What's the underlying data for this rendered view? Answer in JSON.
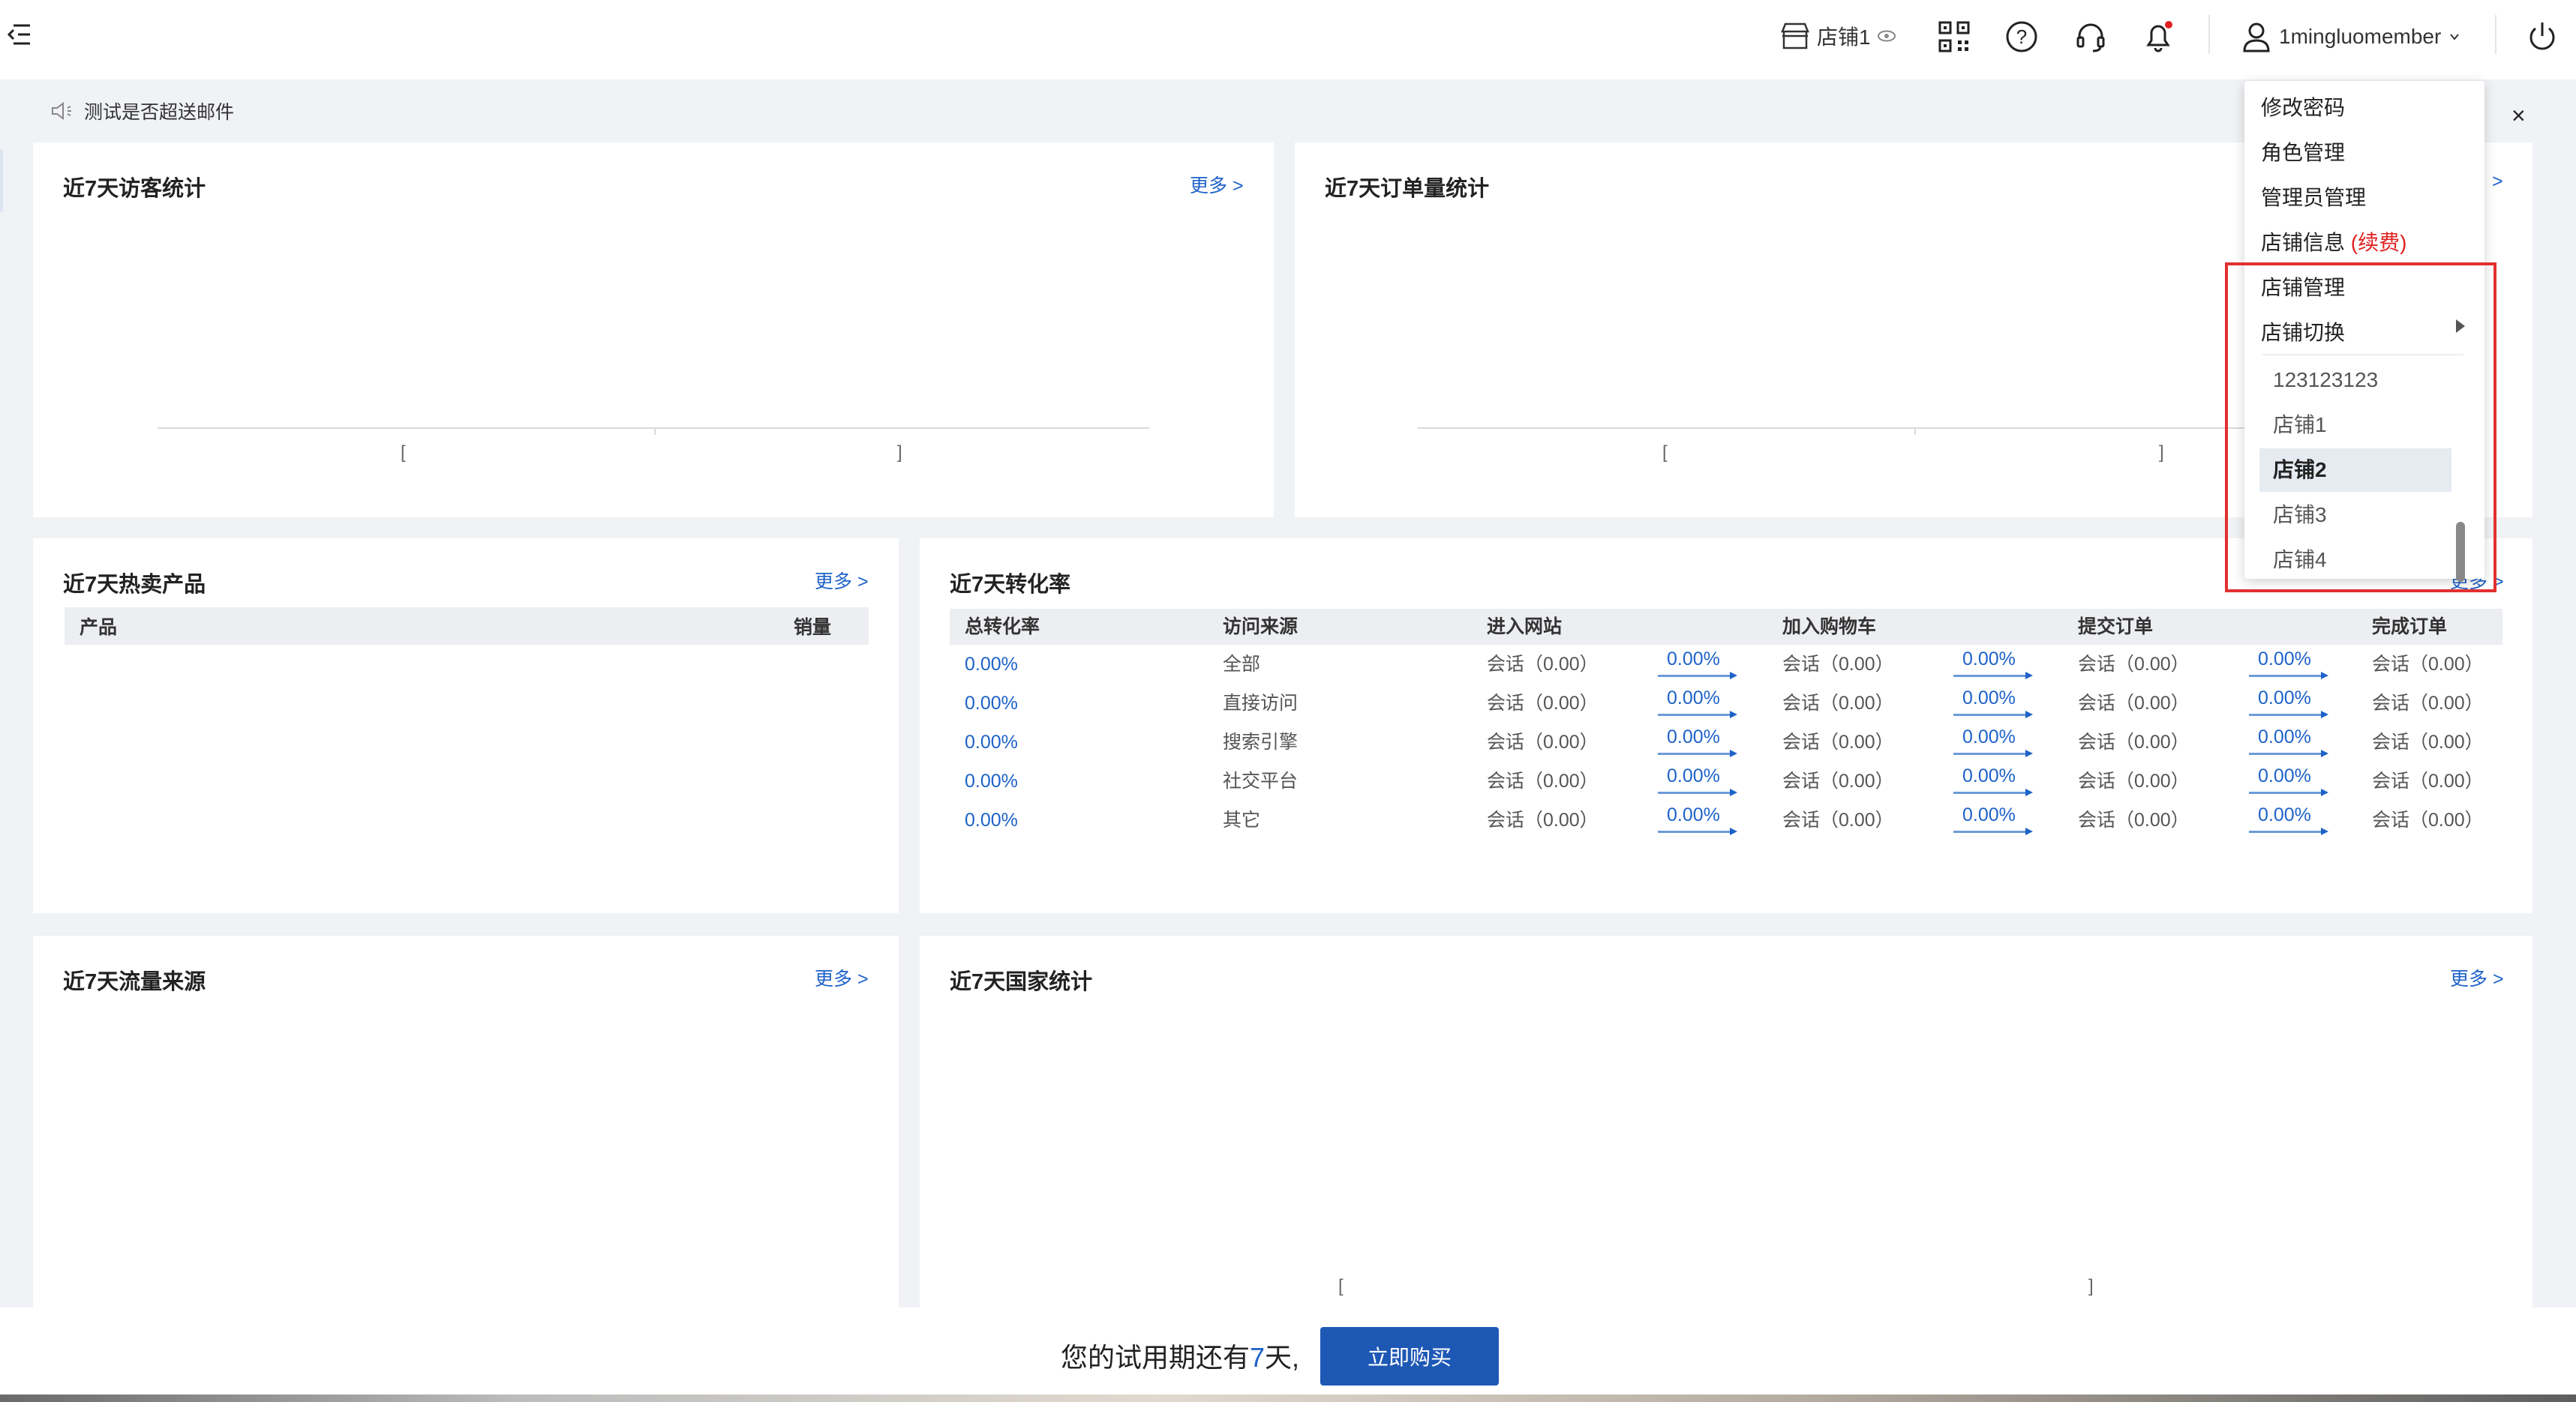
{
  "header": {
    "shop_name": "店铺1",
    "username": "1mingluomember"
  },
  "notice": {
    "text": "测试是否超送邮件"
  },
  "cards": {
    "visitors": {
      "title": "近7天访客统计",
      "more": "更多 >",
      "bracket_left": "[",
      "bracket_right": "]"
    },
    "orders": {
      "title": "近7天订单量统计",
      "more": ">",
      "bracket_left": "[",
      "bracket_right": "]"
    },
    "hot_products": {
      "title": "近7天热卖产品",
      "more": "更多 >",
      "col_product": "产品",
      "col_sales": "销量"
    },
    "conversion": {
      "title": "近7天转化率",
      "more": "更多 >"
    },
    "traffic": {
      "title": "近7天流量来源",
      "more": "更多 >"
    },
    "country": {
      "title": "近7天国家统计",
      "more": "更多 >",
      "bracket_left": "[",
      "bracket_right": "]"
    }
  },
  "conversion_table": {
    "headers": [
      "总转化率",
      "访问来源",
      "进入网站",
      "加入购物车",
      "提交订单",
      "完成订单"
    ],
    "rows": [
      {
        "rate": "0.00%",
        "source": "全部",
        "enter": "会话（0.00）",
        "p1": "0.00%",
        "cart": "会话（0.00）",
        "p2": "0.00%",
        "submit": "会话（0.00）",
        "p3": "0.00%",
        "done": "会话（0.00）"
      },
      {
        "rate": "0.00%",
        "source": "直接访问",
        "enter": "会话（0.00）",
        "p1": "0.00%",
        "cart": "会话（0.00）",
        "p2": "0.00%",
        "submit": "会话（0.00）",
        "p3": "0.00%",
        "done": "会话（0.00）"
      },
      {
        "rate": "0.00%",
        "source": "搜索引擎",
        "enter": "会话（0.00）",
        "p1": "0.00%",
        "cart": "会话（0.00）",
        "p2": "0.00%",
        "submit": "会话（0.00）",
        "p3": "0.00%",
        "done": "会话（0.00）"
      },
      {
        "rate": "0.00%",
        "source": "社交平台",
        "enter": "会话（0.00）",
        "p1": "0.00%",
        "cart": "会话（0.00）",
        "p2": "0.00%",
        "submit": "会话（0.00）",
        "p3": "0.00%",
        "done": "会话（0.00）"
      },
      {
        "rate": "0.00%",
        "source": "其它",
        "enter": "会话（0.00）",
        "p1": "0.00%",
        "cart": "会话（0.00）",
        "p2": "0.00%",
        "submit": "会话（0.00）",
        "p3": "0.00%",
        "done": "会话（0.00）"
      }
    ]
  },
  "dropdown": {
    "change_password": "修改密码",
    "role_manage": "角色管理",
    "admin_manage": "管理员管理",
    "shop_info": "店铺信息",
    "renew": "(续费)",
    "shop_manage": "店铺管理",
    "shop_switch": "店铺切换",
    "shops": [
      "123123123",
      "店铺1",
      "店铺2",
      "店铺3",
      "店铺4"
    ],
    "active_shop": "店铺2"
  },
  "trial": {
    "prefix": "您的试用期还有",
    "days": "7",
    "suffix": "天,",
    "buy_label": "立即购买"
  },
  "icons": {
    "menu": "menu-fold-icon",
    "shop": "store-icon",
    "eye": "eye-icon",
    "qr": "qrcode-icon",
    "help": "question-icon",
    "service": "headset-icon",
    "bell": "bell-icon",
    "user": "user-icon",
    "power": "power-icon",
    "sound": "speaker-icon",
    "close": "close-icon"
  },
  "colors": {
    "accent": "#1e62c9",
    "buy_button": "#1e58b5",
    "notify_dot": "#e02020",
    "highlight_box": "#e23030"
  }
}
